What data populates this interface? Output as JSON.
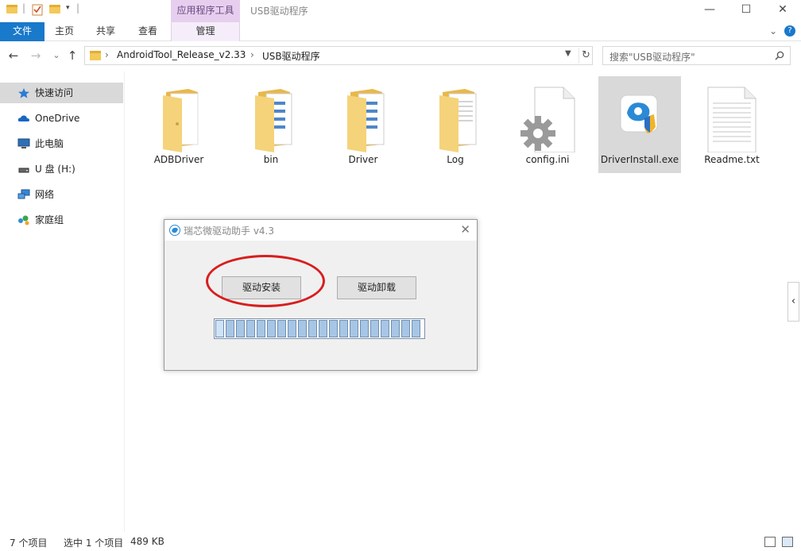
{
  "window": {
    "title": "USB驱动程序",
    "context_tab_header": "应用程序工具",
    "controls": {
      "minimize": "—",
      "maximize": "☐",
      "close": "✕"
    }
  },
  "ribbon": {
    "tabs": [
      {
        "label": "文件"
      },
      {
        "label": "主页"
      },
      {
        "label": "共享"
      },
      {
        "label": "查看"
      },
      {
        "label": "管理"
      }
    ],
    "collapse_glyph": "⌄",
    "help_glyph": "?"
  },
  "address_bar": {
    "back": "←",
    "forward": "→",
    "recent": "⌄",
    "up": "↑",
    "crumbs": [
      "AndroidTool_Release_v2.33",
      "USB驱动程序"
    ],
    "separator": "›"
  },
  "search": {
    "placeholder": "搜索\"USB驱动程序\""
  },
  "nav_pane": {
    "items": [
      {
        "label": "快速访问",
        "icon": "star-icon"
      },
      {
        "label": "OneDrive",
        "icon": "cloud-icon"
      },
      {
        "label": "此电脑",
        "icon": "computer-icon"
      },
      {
        "label": "U 盘 (H:)",
        "icon": "usb-drive-icon"
      },
      {
        "label": "网络",
        "icon": "network-icon"
      },
      {
        "label": "家庭组",
        "icon": "homegroup-icon"
      }
    ]
  },
  "files": [
    {
      "name": "ADBDriver",
      "type": "folder"
    },
    {
      "name": "bin",
      "type": "folder"
    },
    {
      "name": "Driver",
      "type": "folder"
    },
    {
      "name": "Log",
      "type": "folder"
    },
    {
      "name": "config.ini",
      "type": "config"
    },
    {
      "name": "DriverInstall.exe",
      "type": "exe",
      "selected": true
    },
    {
      "name": "Readme.txt",
      "type": "text"
    }
  ],
  "dialog": {
    "title": "瑞芯微驱动助手 v4.3",
    "install_button": "驱动安装",
    "uninstall_button": "驱动卸载",
    "progress_segments": 20,
    "close_glyph": "✕"
  },
  "status_bar": {
    "item_count": "7 个项目",
    "selected": "选中 1 个项目",
    "size": "489 KB"
  },
  "edge_handle": "‹",
  "colors": {
    "accent": "#1979ca",
    "context_tab": "#e6cfee",
    "annotation": "#d81e1e"
  }
}
